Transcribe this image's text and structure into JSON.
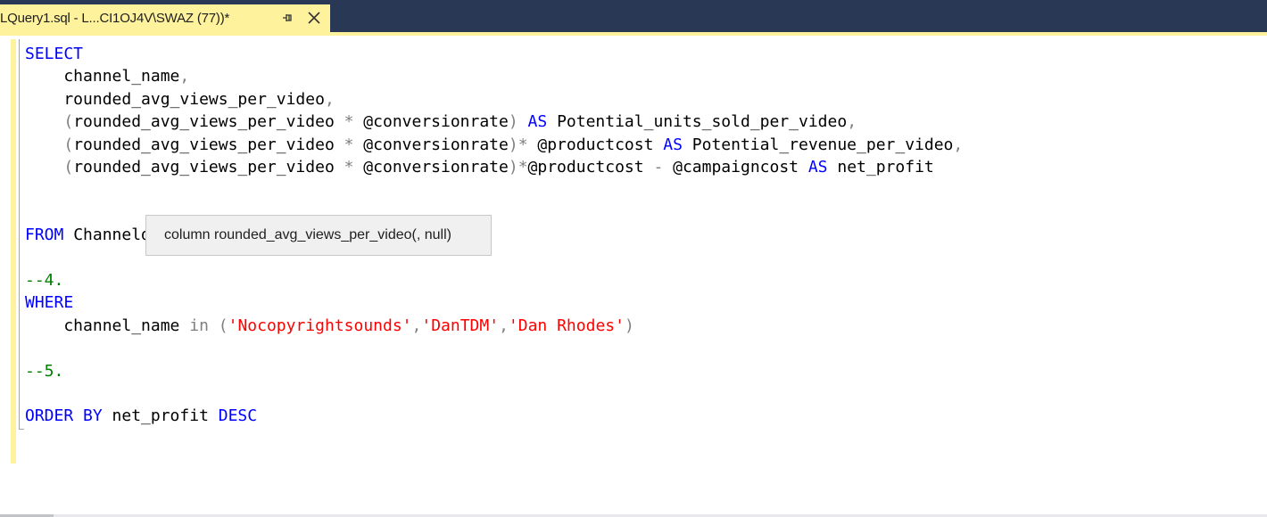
{
  "tab": {
    "title": "LQuery1.sql - L...CI1OJ4V\\SWAZ (77))*",
    "pin_icon": "pin-icon",
    "close_icon": "close-icon"
  },
  "colors": {
    "tab_active": "#fff29d",
    "tabstrip": "#293955",
    "keyword": "#0000ff",
    "string": "#ff0000",
    "comment": "#008000",
    "operator": "#808080"
  },
  "code_lines": [
    [
      {
        "t": "kw",
        "v": "SELECT"
      }
    ],
    [
      {
        "t": "id",
        "v": "    channel_name"
      },
      {
        "t": "op",
        "v": ","
      }
    ],
    [
      {
        "t": "id",
        "v": "    rounded_avg_views_per_video"
      },
      {
        "t": "op",
        "v": ","
      }
    ],
    [
      {
        "t": "op",
        "v": "    ("
      },
      {
        "t": "id",
        "v": "rounded_avg_views_per_video "
      },
      {
        "t": "op",
        "v": "*"
      },
      {
        "t": "id",
        "v": " @conversionrate"
      },
      {
        "t": "op",
        "v": ")"
      },
      {
        "t": "id",
        "v": " "
      },
      {
        "t": "kw",
        "v": "AS"
      },
      {
        "t": "id",
        "v": " Potential_units_sold_per_video"
      },
      {
        "t": "op",
        "v": ","
      }
    ],
    [
      {
        "t": "op",
        "v": "    ("
      },
      {
        "t": "id",
        "v": "rounded_avg_views_per_video "
      },
      {
        "t": "op",
        "v": "*"
      },
      {
        "t": "id",
        "v": " @conversionrate"
      },
      {
        "t": "op",
        "v": ")*"
      },
      {
        "t": "id",
        "v": " @productcost "
      },
      {
        "t": "kw",
        "v": "AS"
      },
      {
        "t": "id",
        "v": " Potential_revenue_per_video"
      },
      {
        "t": "op",
        "v": ","
      }
    ],
    [
      {
        "t": "op",
        "v": "    ("
      },
      {
        "t": "id",
        "v": "rounded_avg_views_per_video "
      },
      {
        "t": "op",
        "v": "*"
      },
      {
        "t": "id",
        "v": " @conversionrate"
      },
      {
        "t": "op",
        "v": ")*"
      },
      {
        "t": "id",
        "v": "@productcost "
      },
      {
        "t": "op",
        "v": "-"
      },
      {
        "t": "id",
        "v": " @campaigncost "
      },
      {
        "t": "kw",
        "v": "AS"
      },
      {
        "t": "id",
        "v": " net_profit"
      }
    ],
    [],
    [],
    [
      {
        "t": "kw",
        "v": "FROM"
      },
      {
        "t": "id",
        "v": " Channeldata"
      }
    ],
    [],
    [
      {
        "t": "cmt",
        "v": "--4."
      }
    ],
    [
      {
        "t": "kw",
        "v": "WHERE"
      }
    ],
    [
      {
        "t": "id",
        "v": "    channel_name "
      },
      {
        "t": "op",
        "v": "in"
      },
      {
        "t": "id",
        "v": " "
      },
      {
        "t": "op",
        "v": "("
      },
      {
        "t": "str",
        "v": "'Nocopyrightsounds'"
      },
      {
        "t": "op",
        "v": ","
      },
      {
        "t": "str",
        "v": "'DanTDM'"
      },
      {
        "t": "op",
        "v": ","
      },
      {
        "t": "str",
        "v": "'Dan Rhodes'"
      },
      {
        "t": "op",
        "v": ")"
      }
    ],
    [],
    [
      {
        "t": "cmt",
        "v": "--5."
      }
    ],
    [],
    [
      {
        "t": "kw",
        "v": "ORDER BY"
      },
      {
        "t": "id",
        "v": " net_profit "
      },
      {
        "t": "kw",
        "v": "DESC"
      }
    ]
  ],
  "tooltip": {
    "text": "column rounded_avg_views_per_video(, null)"
  }
}
